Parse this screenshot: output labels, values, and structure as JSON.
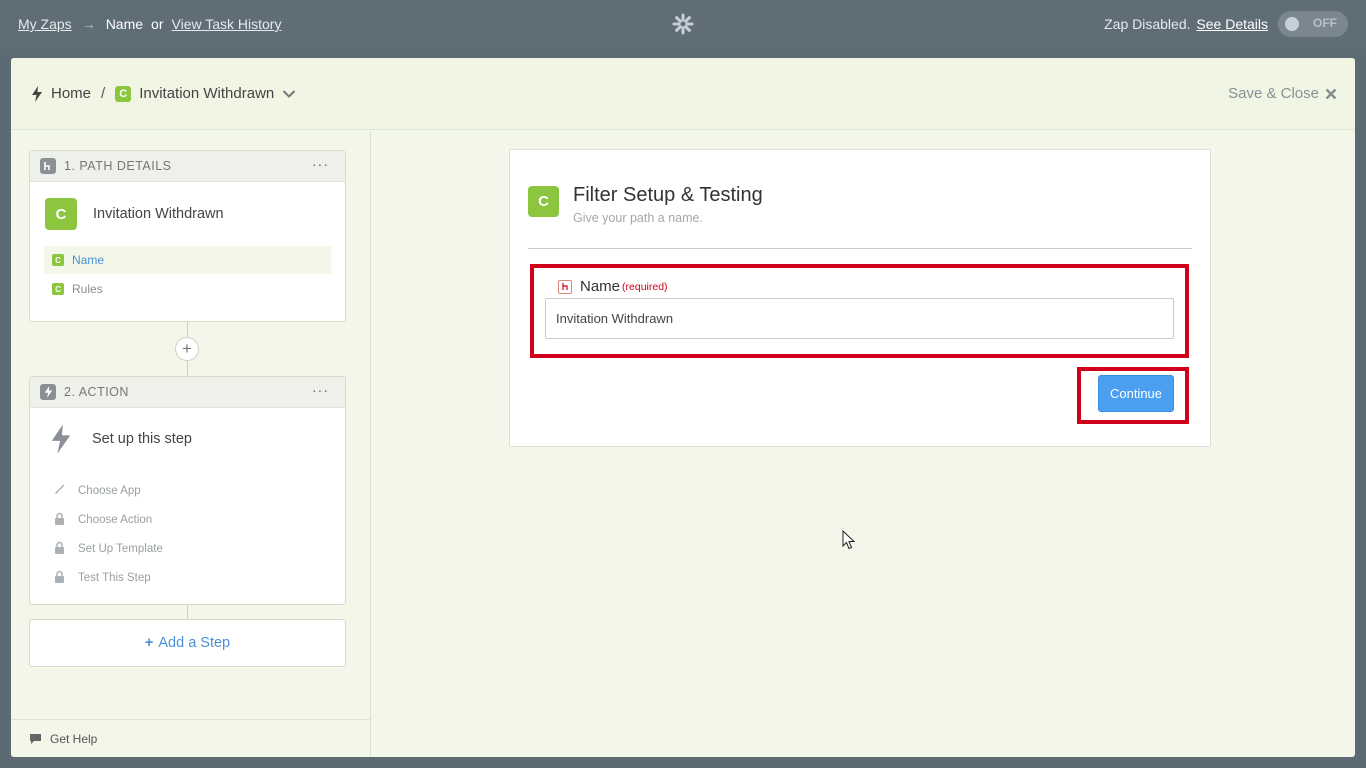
{
  "topbar": {
    "my_zaps": "My Zaps",
    "arrow": "→",
    "current": "Name",
    "or": "or",
    "task_history": "View Task History",
    "status_prefix": "Zap Disabled.",
    "see_details": "See Details",
    "toggle_label": "OFF"
  },
  "header": {
    "home": "Home",
    "slash": "/",
    "badge": "C",
    "zap_name": "Invitation Withdrawn",
    "save_close": "Save & Close"
  },
  "sidebar": {
    "step1": {
      "title": "1. PATH DETAILS",
      "menu": "···",
      "badge": "C",
      "name": "Invitation Withdrawn",
      "items": [
        {
          "badge": "C",
          "label": "Name",
          "active": true
        },
        {
          "badge": "C",
          "label": "Rules",
          "active": false
        }
      ]
    },
    "add_between": "+",
    "step2": {
      "title": "2. ACTION",
      "menu": "···",
      "name": "Set up this step",
      "items": [
        {
          "icon": "pencil-icon",
          "label": "Choose App"
        },
        {
          "icon": "lock-icon",
          "label": "Choose Action"
        },
        {
          "icon": "lock-icon",
          "label": "Set Up Template"
        },
        {
          "icon": "lock-icon",
          "label": "Test This Step"
        }
      ]
    },
    "add_step": "Add a Step",
    "add_step_plus": "+",
    "help": "Get Help"
  },
  "panel": {
    "badge": "C",
    "title": "Filter Setup & Testing",
    "subtitle": "Give your path a name.",
    "field_label": "Name",
    "field_required": "(required)",
    "field_value": "Invitation Withdrawn",
    "continue": "Continue"
  },
  "colors": {
    "accent_green": "#8cc63f",
    "link_blue": "#4a90d9",
    "button_blue": "#4a9ff0",
    "highlight_red": "#d0021b",
    "topbar": "#5f6d77"
  }
}
